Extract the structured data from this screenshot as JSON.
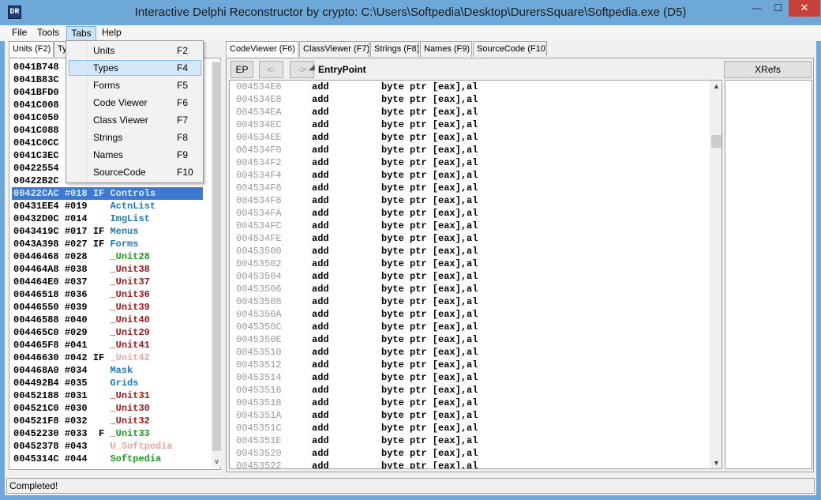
{
  "window": {
    "title": "Interactive Delphi Reconstructor by crypto: C:\\Users\\Softpedia\\Desktop\\DurersSquare\\Softpedia.exe (D5)",
    "icon_text": "DR",
    "minimize": "—",
    "maximize": "☐",
    "close": "✕"
  },
  "menu": {
    "file": "File",
    "tools": "Tools",
    "tabs": "Tabs",
    "help": "Help"
  },
  "tabs_menu": [
    {
      "label": "Units",
      "shortcut": "F2"
    },
    {
      "label": "Types",
      "shortcut": "F4"
    },
    {
      "label": "Forms",
      "shortcut": "F5"
    },
    {
      "label": "Code Viewer",
      "shortcut": "F6"
    },
    {
      "label": "Class Viewer",
      "shortcut": "F7"
    },
    {
      "label": "Strings",
      "shortcut": "F8"
    },
    {
      "label": "Names",
      "shortcut": "F9"
    },
    {
      "label": "SourceCode",
      "shortcut": "F10"
    }
  ],
  "left_tabs": {
    "units": "Units (F2)",
    "types": "Ty"
  },
  "units": [
    {
      "addr": "0041B748",
      "num": "",
      "flags": "",
      "name": "",
      "color": "#000000"
    },
    {
      "addr": "0041B83C",
      "num": "",
      "flags": "",
      "name": "",
      "color": "#000000"
    },
    {
      "addr": "0041BFD0",
      "num": "",
      "flags": "",
      "name": "",
      "color": "#000000"
    },
    {
      "addr": "0041C008",
      "num": "",
      "flags": "",
      "name": "",
      "color": "#000000"
    },
    {
      "addr": "0041C050",
      "num": "",
      "flags": "",
      "name": "",
      "color": "#000000"
    },
    {
      "addr": "0041C088",
      "num": "",
      "flags": "",
      "name": "",
      "color": "#000000"
    },
    {
      "addr": "0041C0CC",
      "num": "",
      "flags": "",
      "name": "",
      "color": "#000000"
    },
    {
      "addr": "0041C3EC",
      "num": "",
      "flags": "",
      "name": "",
      "color": "#000000"
    },
    {
      "addr": "00422554",
      "num": "",
      "flags": "",
      "name": "",
      "color": "#000000"
    },
    {
      "addr": "00422B2C",
      "num": "",
      "flags": "",
      "name": "",
      "color": "#000000"
    },
    {
      "addr": "00422CAC",
      "num": "#018",
      "flags": "IF",
      "name": "Controls",
      "color": "#d9e7f8"
    },
    {
      "addr": "00431EE4",
      "num": "#019",
      "flags": "  ",
      "name": "ActnList",
      "color": "#1a7ab8"
    },
    {
      "addr": "00432D0C",
      "num": "#014",
      "flags": "  ",
      "name": "ImgList",
      "color": "#1a7ab8"
    },
    {
      "addr": "0043419C",
      "num": "#017",
      "flags": "IF",
      "name": "Menus",
      "color": "#1a7ab8"
    },
    {
      "addr": "0043A398",
      "num": "#027",
      "flags": "IF",
      "name": "Forms",
      "color": "#1a7ab8"
    },
    {
      "addr": "00446468",
      "num": "#028",
      "flags": "  ",
      "name": "_Unit28",
      "color": "#1f9a1f"
    },
    {
      "addr": "004464A8",
      "num": "#038",
      "flags": "  ",
      "name": "_Unit38",
      "color": "#a01818"
    },
    {
      "addr": "004464E0",
      "num": "#037",
      "flags": "  ",
      "name": "_Unit37",
      "color": "#a01818"
    },
    {
      "addr": "00446518",
      "num": "#036",
      "flags": "  ",
      "name": "_Unit36",
      "color": "#a01818"
    },
    {
      "addr": "00446550",
      "num": "#039",
      "flags": "  ",
      "name": "_Unit39",
      "color": "#a01818"
    },
    {
      "addr": "00446588",
      "num": "#040",
      "flags": "  ",
      "name": "_Unit40",
      "color": "#a01818"
    },
    {
      "addr": "004465C0",
      "num": "#029",
      "flags": "  ",
      "name": "_Unit29",
      "color": "#a01818"
    },
    {
      "addr": "004465F8",
      "num": "#041",
      "flags": "  ",
      "name": "_Unit41",
      "color": "#a01818"
    },
    {
      "addr": "00446630",
      "num": "#042",
      "flags": "IF",
      "name": "_Unit42",
      "color": "#e8a6a6"
    },
    {
      "addr": "004468A0",
      "num": "#034",
      "flags": "  ",
      "name": "Mask",
      "color": "#1a7ab8"
    },
    {
      "addr": "004492B4",
      "num": "#035",
      "flags": "  ",
      "name": "Grids",
      "color": "#1a7ab8"
    },
    {
      "addr": "00452188",
      "num": "#031",
      "flags": "  ",
      "name": "_Unit31",
      "color": "#a01818"
    },
    {
      "addr": "004521C0",
      "num": "#030",
      "flags": "  ",
      "name": "_Unit30",
      "color": "#a01818"
    },
    {
      "addr": "004521F8",
      "num": "#032",
      "flags": "  ",
      "name": "_Unit32",
      "color": "#a01818"
    },
    {
      "addr": "00452230",
      "num": "#033",
      "flags": " F",
      "name": "_Unit33",
      "color": "#1f9a1f"
    },
    {
      "addr": "00452378",
      "num": "#043",
      "flags": "  ",
      "name": "U_Softpedia",
      "color": "#e8a6a6"
    },
    {
      "addr": "0045314C",
      "num": "#044",
      "flags": "  ",
      "name": "Softpedia",
      "color": "#1f9a1f"
    }
  ],
  "right_tabs": [
    "CodeViewer (F6)",
    "ClassViewer (F7)",
    "Strings (F8)",
    "Names (F9)",
    "SourceCode (F10)"
  ],
  "toolbar": {
    "ep": "EP",
    "back": "<-",
    "forward": "->",
    "entry_arrow": "◢",
    "entry": "EntryPoint",
    "xrefs": "XRefs"
  },
  "code": [
    {
      "addr": "004534E6",
      "mn": "add",
      "op": "byte ptr [eax],al"
    },
    {
      "addr": "004534E8",
      "mn": "add",
      "op": "byte ptr [eax],al"
    },
    {
      "addr": "004534EA",
      "mn": "add",
      "op": "byte ptr [eax],al"
    },
    {
      "addr": "004534EC",
      "mn": "add",
      "op": "byte ptr [eax],al"
    },
    {
      "addr": "004534EE",
      "mn": "add",
      "op": "byte ptr [eax],al"
    },
    {
      "addr": "004534F0",
      "mn": "add",
      "op": "byte ptr [eax],al"
    },
    {
      "addr": "004534F2",
      "mn": "add",
      "op": "byte ptr [eax],al"
    },
    {
      "addr": "004534F4",
      "mn": "add",
      "op": "byte ptr [eax],al"
    },
    {
      "addr": "004534F6",
      "mn": "add",
      "op": "byte ptr [eax],al"
    },
    {
      "addr": "004534F8",
      "mn": "add",
      "op": "byte ptr [eax],al"
    },
    {
      "addr": "004534FA",
      "mn": "add",
      "op": "byte ptr [eax],al"
    },
    {
      "addr": "004534FC",
      "mn": "add",
      "op": "byte ptr [eax],al"
    },
    {
      "addr": "004534FE",
      "mn": "add",
      "op": "byte ptr [eax],al"
    },
    {
      "addr": "00453500",
      "mn": "add",
      "op": "byte ptr [eax],al"
    },
    {
      "addr": "00453502",
      "mn": "add",
      "op": "byte ptr [eax],al"
    },
    {
      "addr": "00453504",
      "mn": "add",
      "op": "byte ptr [eax],al"
    },
    {
      "addr": "00453506",
      "mn": "add",
      "op": "byte ptr [eax],al"
    },
    {
      "addr": "00453508",
      "mn": "add",
      "op": "byte ptr [eax],al"
    },
    {
      "addr": "0045350A",
      "mn": "add",
      "op": "byte ptr [eax],al"
    },
    {
      "addr": "0045350C",
      "mn": "add",
      "op": "byte ptr [eax],al"
    },
    {
      "addr": "0045350E",
      "mn": "add",
      "op": "byte ptr [eax],al"
    },
    {
      "addr": "00453510",
      "mn": "add",
      "op": "byte ptr [eax],al"
    },
    {
      "addr": "00453512",
      "mn": "add",
      "op": "byte ptr [eax],al"
    },
    {
      "addr": "00453514",
      "mn": "add",
      "op": "byte ptr [eax],al"
    },
    {
      "addr": "00453516",
      "mn": "add",
      "op": "byte ptr [eax],al"
    },
    {
      "addr": "00453518",
      "mn": "add",
      "op": "byte ptr [eax],al"
    },
    {
      "addr": "0045351A",
      "mn": "add",
      "op": "byte ptr [eax],al"
    },
    {
      "addr": "0045351C",
      "mn": "add",
      "op": "byte ptr [eax],al"
    },
    {
      "addr": "0045351E",
      "mn": "add",
      "op": "byte ptr [eax],al"
    },
    {
      "addr": "00453520",
      "mn": "add",
      "op": "byte ptr [eax],al"
    },
    {
      "addr": "00453522",
      "mn": "add",
      "op": "byte ptr [eax],al"
    }
  ],
  "status": {
    "text": "Completed!"
  },
  "scroll_arrows": {
    "up": "▲",
    "down": "▼",
    "list_down": "∨"
  }
}
